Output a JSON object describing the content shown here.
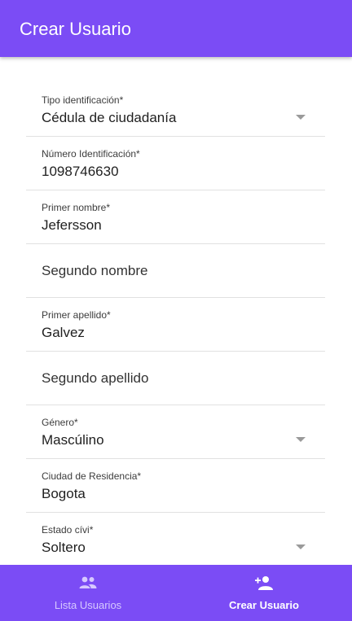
{
  "header": {
    "title": "Crear Usuario"
  },
  "form": {
    "tipo_identificacion": {
      "label": "Tipo identificación*",
      "value": "Cédula de ciudadanía"
    },
    "numero_identificacion": {
      "label": "Número Identificación*",
      "value": "1098746630"
    },
    "primer_nombre": {
      "label": "Primer nombre*",
      "value": "Jefersson"
    },
    "segundo_nombre": {
      "placeholder": "Segundo nombre"
    },
    "primer_apellido": {
      "label": "Primer apellido*",
      "value": "Galvez"
    },
    "segundo_apellido": {
      "placeholder": "Segundo apellido"
    },
    "genero": {
      "label": "Género*",
      "value": "Mascúlino"
    },
    "ciudad_residencia": {
      "label": "Ciudad de Residencia*",
      "value": "Bogota"
    },
    "estado_civil": {
      "label": "Estado cívi*",
      "value": "Soltero"
    }
  },
  "nav": {
    "lista_usuarios": {
      "label": "Lista Usuarios",
      "icon": "people-icon"
    },
    "crear_usuario": {
      "label": "Crear Usuario",
      "icon": "person-add-icon"
    }
  },
  "colors": {
    "primary": "#7b4cf5",
    "inactive_nav_text": "#d7c9ff"
  }
}
